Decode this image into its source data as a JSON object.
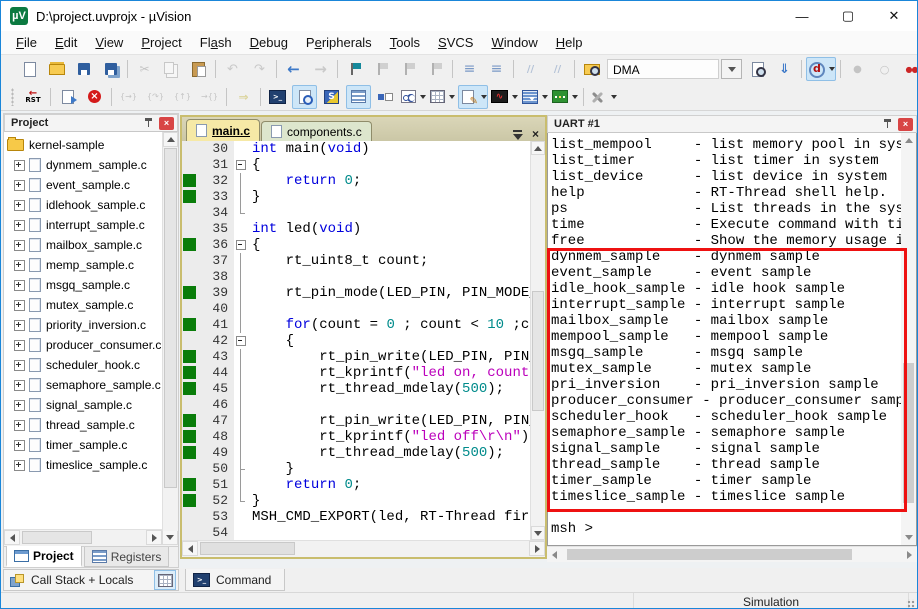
{
  "window": {
    "title": "D:\\project.uvprojx - µVision",
    "status": "Simulation"
  },
  "menu": {
    "items": [
      {
        "label": "File",
        "u": 0
      },
      {
        "label": "Edit",
        "u": 0
      },
      {
        "label": "View",
        "u": 0
      },
      {
        "label": "Project",
        "u": 0
      },
      {
        "label": "Flash",
        "u": 2
      },
      {
        "label": "Debug",
        "u": 0
      },
      {
        "label": "Peripherals",
        "u": 1
      },
      {
        "label": "Tools",
        "u": 0
      },
      {
        "label": "SVCS",
        "u": 0
      },
      {
        "label": "Window",
        "u": 0
      },
      {
        "label": "Help",
        "u": 0
      }
    ]
  },
  "toolbars": {
    "row1": [
      {
        "t": "b",
        "n": "new-file",
        "g": "new"
      },
      {
        "t": "b",
        "n": "open-file",
        "g": "open"
      },
      {
        "t": "b",
        "n": "save",
        "g": "save"
      },
      {
        "t": "b",
        "n": "save-all",
        "g": "saveall"
      },
      {
        "t": "s"
      },
      {
        "t": "b",
        "n": "cut",
        "g": "cut",
        "d": 1
      },
      {
        "t": "b",
        "n": "copy",
        "g": "copy",
        "d": 1
      },
      {
        "t": "b",
        "n": "paste",
        "g": "paste"
      },
      {
        "t": "s"
      },
      {
        "t": "b",
        "n": "undo",
        "g": "undo",
        "d": 1
      },
      {
        "t": "b",
        "n": "redo",
        "g": "redo",
        "d": 1
      },
      {
        "t": "s"
      },
      {
        "t": "b",
        "n": "navigate-back",
        "g": "back"
      },
      {
        "t": "b",
        "n": "navigate-forward",
        "g": "fwd",
        "d": 1
      },
      {
        "t": "s"
      },
      {
        "t": "b",
        "n": "bookmark-toggle",
        "g": "flag"
      },
      {
        "t": "b",
        "n": "bookmark-next",
        "g": "flagn",
        "d": 1
      },
      {
        "t": "b",
        "n": "bookmark-prev",
        "g": "flagp",
        "d": 1
      },
      {
        "t": "b",
        "n": "bookmark-clear-all",
        "g": "flagx",
        "d": 1
      },
      {
        "t": "s"
      },
      {
        "t": "b",
        "n": "indent",
        "g": "indent"
      },
      {
        "t": "b",
        "n": "outdent",
        "g": "outdent"
      },
      {
        "t": "s"
      },
      {
        "t": "b",
        "n": "comment-selection",
        "g": "comment",
        "d": 1
      },
      {
        "t": "b",
        "n": "uncomment-selection",
        "g": "uncomment",
        "d": 1
      },
      {
        "t": "s"
      },
      {
        "t": "b",
        "n": "find-in-files",
        "g": "findfolder"
      },
      {
        "t": "combo",
        "n": "search-box",
        "value": "DMA"
      },
      {
        "t": "b",
        "n": "find-in-files-doc",
        "g": "finddoc"
      },
      {
        "t": "b",
        "n": "incremental-find",
        "g": "incfind"
      },
      {
        "t": "s"
      },
      {
        "t": "b",
        "n": "start-stop-debug-session",
        "g": "debugd",
        "on": 1,
        "caret": 1
      },
      {
        "t": "s"
      },
      {
        "t": "b",
        "n": "insert-remove-breakpoint",
        "g": "bpgray",
        "d": 1
      },
      {
        "t": "b",
        "n": "enable-disable-breakpoint",
        "g": "bpwhite",
        "d": 1
      },
      {
        "t": "b",
        "n": "disable-all-breakpoints",
        "g": "bpred2"
      },
      {
        "t": "b",
        "n": "kill-all-breakpoints",
        "g": "bpredx"
      },
      {
        "t": "s"
      },
      {
        "t": "b",
        "n": "manage-windows-layout",
        "g": "winicon",
        "on": 1
      }
    ],
    "row2": [
      {
        "t": "b",
        "n": "reset-cpu",
        "g": "rst",
        "text": "RST"
      },
      {
        "t": "s"
      },
      {
        "t": "b",
        "n": "run",
        "g": "run"
      },
      {
        "t": "b",
        "n": "stop",
        "g": "stop"
      },
      {
        "t": "s"
      },
      {
        "t": "b",
        "n": "step",
        "g": "step",
        "d": 1
      },
      {
        "t": "b",
        "n": "step-over",
        "g": "stepover",
        "d": 1
      },
      {
        "t": "b",
        "n": "step-out",
        "g": "stepout",
        "d": 1
      },
      {
        "t": "b",
        "n": "run-to-cursor-line",
        "g": "runto",
        "d": 1
      },
      {
        "t": "s"
      },
      {
        "t": "b",
        "n": "show-next-statement",
        "g": "shownext",
        "d": 1
      },
      {
        "t": "s"
      },
      {
        "t": "b",
        "n": "command-window",
        "g": "console"
      },
      {
        "t": "b",
        "n": "disassembly-window",
        "g": "disasm",
        "on": 1
      },
      {
        "t": "b",
        "n": "serial-windows",
        "g": "serials"
      },
      {
        "t": "b",
        "n": "registers-window",
        "g": "regs",
        "on": 1
      },
      {
        "t": "b",
        "n": "symbols-window",
        "g": "symbols"
      },
      {
        "t": "b",
        "n": "watch-windows",
        "g": "watch",
        "caret": 1
      },
      {
        "t": "b",
        "n": "memory-windows",
        "g": "memory",
        "caret": 1
      },
      {
        "t": "b",
        "n": "serial-uart-window",
        "g": "uartwin",
        "on": 1,
        "caret": 1
      },
      {
        "t": "b",
        "n": "analysis-windows",
        "g": "logic",
        "caret": 1
      },
      {
        "t": "b",
        "n": "system-viewer",
        "g": "sysview",
        "caret": 1
      },
      {
        "t": "b",
        "n": "toolbox",
        "g": "toolbox",
        "caret": 1
      },
      {
        "t": "s"
      },
      {
        "t": "b",
        "n": "debug-toolbar-settings",
        "g": "wrench",
        "caret": 1
      }
    ]
  },
  "project_panel": {
    "title": "Project",
    "root": "kernel-sample",
    "files": [
      "dynmem_sample.c",
      "event_sample.c",
      "idlehook_sample.c",
      "interrupt_sample.c",
      "mailbox_sample.c",
      "memp_sample.c",
      "msgq_sample.c",
      "mutex_sample.c",
      "priority_inversion.c",
      "producer_consumer.c",
      "scheduler_hook.c",
      "semaphore_sample.c",
      "signal_sample.c",
      "thread_sample.c",
      "timer_sample.c",
      "timeslice_sample.c"
    ],
    "tabs": [
      {
        "label": "Project"
      },
      {
        "label": "Registers"
      }
    ],
    "callstack_label": "Call Stack + Locals"
  },
  "editor": {
    "tabs": [
      {
        "label": "main.c"
      },
      {
        "label": "components.c"
      }
    ],
    "lines": [
      {
        "n": 30,
        "cov": false,
        "fold": "",
        "segs": [
          [
            "int",
            "k"
          ],
          [
            " main(",
            "p"
          ],
          [
            "void",
            "k"
          ],
          [
            ")",
            "p"
          ]
        ]
      },
      {
        "n": 31,
        "cov": false,
        "fold": "box",
        "segs": [
          [
            "{",
            "p"
          ]
        ]
      },
      {
        "n": 32,
        "cov": true,
        "fold": "line",
        "segs": [
          [
            "    ",
            "p"
          ],
          [
            "return",
            "k"
          ],
          [
            " ",
            "p"
          ],
          [
            "0",
            "n"
          ],
          [
            ";",
            "p"
          ]
        ]
      },
      {
        "n": 33,
        "cov": true,
        "fold": "line",
        "segs": [
          [
            "}",
            "p"
          ]
        ]
      },
      {
        "n": 34,
        "cov": false,
        "fold": "end",
        "segs": []
      },
      {
        "n": 35,
        "cov": false,
        "fold": "",
        "segs": [
          [
            "int",
            "k"
          ],
          [
            " led(",
            "p"
          ],
          [
            "void",
            "k"
          ],
          [
            ")",
            "p"
          ]
        ]
      },
      {
        "n": 36,
        "cov": true,
        "fold": "box",
        "segs": [
          [
            "{",
            "p"
          ]
        ]
      },
      {
        "n": 37,
        "cov": false,
        "fold": "line",
        "segs": [
          [
            "    rt_uint8_t count;",
            "p"
          ]
        ]
      },
      {
        "n": 38,
        "cov": false,
        "fold": "line",
        "segs": []
      },
      {
        "n": 39,
        "cov": true,
        "fold": "line",
        "segs": [
          [
            "    rt_pin_mode(LED_PIN, PIN_MODE_OUTPUT);",
            "p"
          ]
        ]
      },
      {
        "n": 40,
        "cov": false,
        "fold": "line",
        "segs": []
      },
      {
        "n": 41,
        "cov": true,
        "fold": "line",
        "segs": [
          [
            "    ",
            "p"
          ],
          [
            "for",
            "k"
          ],
          [
            "(count = ",
            "p"
          ],
          [
            "0",
            "n"
          ],
          [
            " ; count < ",
            "p"
          ],
          [
            "10",
            "n"
          ],
          [
            " ;count++)",
            "p"
          ]
        ]
      },
      {
        "n": 42,
        "cov": false,
        "fold": "box",
        "segs": [
          [
            "    {",
            "p"
          ]
        ]
      },
      {
        "n": 43,
        "cov": true,
        "fold": "line",
        "segs": [
          [
            "        rt_pin_write(LED_PIN, PIN_HIGH);",
            "p"
          ]
        ]
      },
      {
        "n": 44,
        "cov": true,
        "fold": "line",
        "segs": [
          [
            "        rt_kprintf(",
            "p"
          ],
          [
            "\"led on, count : %d\\r\\n\"",
            "s"
          ],
          [
            ", count);",
            "p"
          ]
        ]
      },
      {
        "n": 45,
        "cov": true,
        "fold": "line",
        "segs": [
          [
            "        rt_thread_mdelay(",
            "p"
          ],
          [
            "500",
            "n"
          ],
          [
            ");",
            "p"
          ]
        ]
      },
      {
        "n": 46,
        "cov": false,
        "fold": "line",
        "segs": []
      },
      {
        "n": 47,
        "cov": true,
        "fold": "line",
        "segs": [
          [
            "        rt_pin_write(LED_PIN, PIN_LOW);",
            "p"
          ]
        ]
      },
      {
        "n": 48,
        "cov": true,
        "fold": "line",
        "segs": [
          [
            "        rt_kprintf(",
            "p"
          ],
          [
            "\"led off\\r\\n\"",
            "s"
          ],
          [
            ");",
            "p"
          ]
        ]
      },
      {
        "n": 49,
        "cov": true,
        "fold": "line",
        "segs": [
          [
            "        rt_thread_mdelay(",
            "p"
          ],
          [
            "500",
            "n"
          ],
          [
            ");",
            "p"
          ]
        ]
      },
      {
        "n": 50,
        "cov": false,
        "fold": "tee",
        "segs": [
          [
            "    }",
            "p"
          ]
        ]
      },
      {
        "n": 51,
        "cov": true,
        "fold": "line",
        "segs": [
          [
            "    ",
            "p"
          ],
          [
            "return",
            "k"
          ],
          [
            " ",
            "p"
          ],
          [
            "0",
            "n"
          ],
          [
            ";",
            "p"
          ]
        ]
      },
      {
        "n": 52,
        "cov": true,
        "fold": "end",
        "segs": [
          [
            "}",
            "p"
          ]
        ]
      },
      {
        "n": 53,
        "cov": false,
        "fold": "",
        "segs": [
          [
            "MSH_CMD_EXPORT(led, RT-Thread first led sample);",
            "p"
          ]
        ]
      },
      {
        "n": 54,
        "cov": false,
        "fold": "",
        "segs": []
      }
    ]
  },
  "uart": {
    "title": "UART #1",
    "lines": [
      "list_mempool     - list memory pool in system",
      "list_timer       - list timer in system",
      "list_device      - list device in system",
      "help             - RT-Thread shell help.",
      "ps               - List threads in the system",
      "time             - Execute command with time",
      "free             - Show the memory usage in system",
      "dynmem_sample    - dynmem sample",
      "event_sample     - event sample",
      "idle_hook_sample - idle hook sample",
      "interrupt_sample - interrupt sample",
      "mailbox_sample   - mailbox sample",
      "mempool_sample   - mempool sample",
      "msgq_sample      - msgq sample",
      "mutex_sample     - mutex sample",
      "pri_inversion    - pri_inversion sample",
      "producer_consumer - producer_consumer sample",
      "scheduler_hook   - scheduler_hook sample",
      "semaphore_sample - semaphore sample",
      "signal_sample    - signal sample",
      "thread_sample    - thread sample",
      "timer_sample     - timer sample",
      "timeslice_sample - timeslice sample",
      "",
      "msh >"
    ]
  },
  "bottom": {
    "command_label": "Command"
  },
  "colors": {
    "window_border_blue": "#1a86d9",
    "coverage_green": "#0a7d0a",
    "annotation_red": "#ee1111",
    "keyword_blue": "#0000dd",
    "number_teal": "#008b8b",
    "string_magenta": "#bb00bb",
    "active_tab_yellow": "#f6e9a6",
    "inactive_tab_green": "#dde6cd",
    "toolbar_toggle_blue": "#cde6f8"
  }
}
